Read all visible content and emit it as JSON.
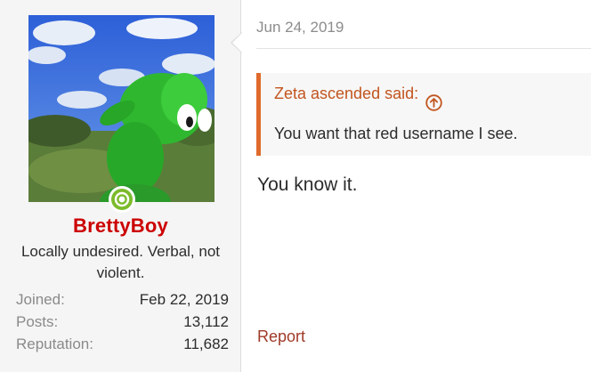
{
  "user": {
    "username": "BrettyBoy",
    "title": "Locally undesired. Verbal, not violent.",
    "online": true,
    "stats": [
      {
        "label": "Joined:",
        "value": "Feb 22, 2019"
      },
      {
        "label": "Posts:",
        "value": "13,112"
      },
      {
        "label": "Reputation:",
        "value": "11,682"
      }
    ]
  },
  "post": {
    "date": "Jun 24, 2019",
    "quote": {
      "author_line": "Zeta ascended said:",
      "text": "You want that red username I see."
    },
    "message": "You know it.",
    "report_label": "Report"
  },
  "colors": {
    "username": "#cc0000",
    "quote_accent": "#e06a2b",
    "quote_title": "#c2551f",
    "report_link": "#a03a28",
    "online_indicator": "#7cbb2b"
  },
  "icons": {
    "quote_jump": "arrow-up-circle-icon",
    "online": "online-status-icon"
  }
}
